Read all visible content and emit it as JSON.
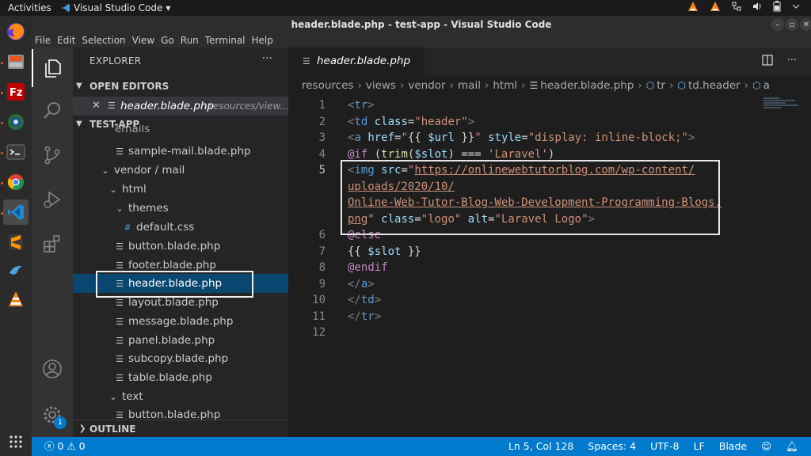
{
  "system": {
    "activities": "Activities",
    "app_name": "Visual Studio Code",
    "app_menu_arrow": "▾"
  },
  "window": {
    "title": "header.blade.php - test-app - Visual Studio Code"
  },
  "menu": [
    "File",
    "Edit",
    "Selection",
    "View",
    "Go",
    "Run",
    "Terminal",
    "Help"
  ],
  "explorer": {
    "title": "EXPLORER",
    "more": "···",
    "open_editors_label": "OPEN EDITORS",
    "open_editor": {
      "close": "✕",
      "name": "header.blade.php",
      "path": "resources/view..."
    },
    "project_label": "TEST-APP",
    "tree": [
      {
        "label": "emails",
        "kind": "folder-partial"
      },
      {
        "label": "sample-mail.blade.php",
        "kind": "file"
      },
      {
        "label": "vendor / mail",
        "kind": "folder"
      },
      {
        "label": "html",
        "kind": "folder"
      },
      {
        "label": "themes",
        "kind": "folder"
      },
      {
        "label": "default.css",
        "kind": "css"
      },
      {
        "label": "button.blade.php",
        "kind": "file"
      },
      {
        "label": "footer.blade.php",
        "kind": "file"
      },
      {
        "label": "header.blade.php",
        "kind": "file",
        "selected": true
      },
      {
        "label": "layout.blade.php",
        "kind": "file"
      },
      {
        "label": "message.blade.php",
        "kind": "file"
      },
      {
        "label": "panel.blade.php",
        "kind": "file"
      },
      {
        "label": "subcopy.blade.php",
        "kind": "file"
      },
      {
        "label": "table.blade.php",
        "kind": "file"
      },
      {
        "label": "text",
        "kind": "folder"
      },
      {
        "label": "button.blade.php",
        "kind": "file"
      }
    ],
    "outline_label": "OUTLINE"
  },
  "editor": {
    "tab_name": "header.blade.php",
    "breadcrumb": [
      "resources",
      "views",
      "vendor",
      "mail",
      "html",
      "header.blade.php",
      "tr",
      "td.header",
      "a"
    ],
    "line_numbers": [
      "1",
      "2",
      "3",
      "4",
      "5",
      "",
      "",
      "",
      "6",
      "7",
      "8",
      "9",
      "10",
      "11",
      "12"
    ]
  },
  "status": {
    "errors": "0",
    "warnings": "0",
    "position": "Ln 5, Col 128",
    "spaces": "Spaces: 4",
    "encoding": "UTF-8",
    "eol": "LF",
    "language": "Blade",
    "notifications_count": "1"
  },
  "icons": {
    "files": "files-icon",
    "search": "search-icon",
    "source_control": "source-control-icon",
    "run": "run-debug-icon",
    "extensions": "extensions-icon",
    "account": "account-icon",
    "settings": "gear-icon"
  },
  "colors": {
    "accent": "#007acc",
    "selection": "#094771",
    "background": "#1e1e1e"
  }
}
